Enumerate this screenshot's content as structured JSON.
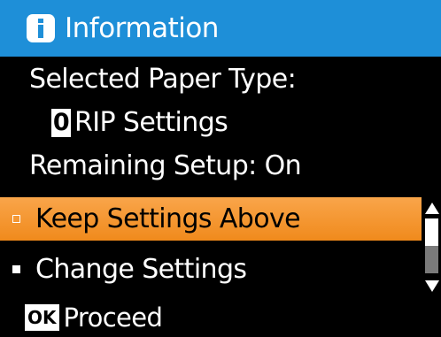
{
  "header": {
    "title": "Information",
    "icon": "info-icon",
    "color": "#1e8fd8"
  },
  "info": {
    "paper_type_label": "Selected Paper Type:",
    "paper_number": "0",
    "paper_type_value": "RIP Settings",
    "remaining_setup": "Remaining Setup: On"
  },
  "menu": {
    "items": [
      {
        "label": "Keep Settings Above",
        "selected": true
      },
      {
        "label": "Change Settings",
        "selected": false
      }
    ],
    "highlight_color": "#f5961f"
  },
  "scrollbar": {
    "position": 0.0
  },
  "footer": {
    "key_label": "OK",
    "action_label": "Proceed"
  }
}
